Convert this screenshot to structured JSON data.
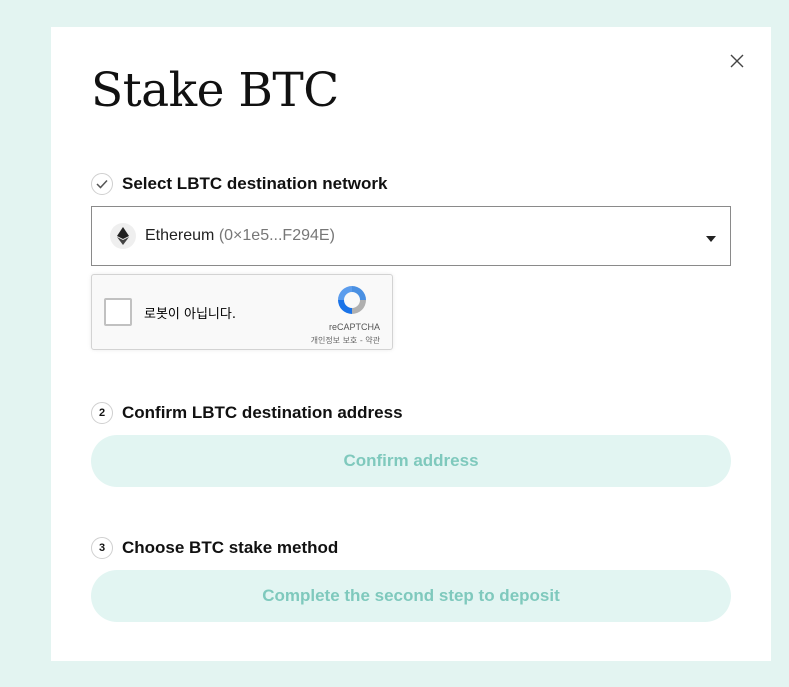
{
  "modal": {
    "title": "Stake BTC",
    "close_icon": "close-icon"
  },
  "steps": [
    {
      "marker": "check",
      "label": "Select LBTC destination network"
    },
    {
      "marker": "2",
      "label": "Confirm LBTC destination address"
    },
    {
      "marker": "3",
      "label": "Choose BTC stake method"
    }
  ],
  "network_select": {
    "network": "Ethereum",
    "address": "(0×1e5...F294E)",
    "icon": "ethereum-icon"
  },
  "captcha": {
    "label": "로봇이 아닙니다.",
    "brand": "reCAPTCHA",
    "links": "개인정보 보호 - 약관"
  },
  "buttons": {
    "confirm_address": "Confirm address",
    "deposit": "Complete the second step to deposit"
  },
  "colors": {
    "page_bg": "#e3f4f1",
    "pill_bg": "#e2f5f2",
    "pill_text": "#7fc9bd"
  }
}
